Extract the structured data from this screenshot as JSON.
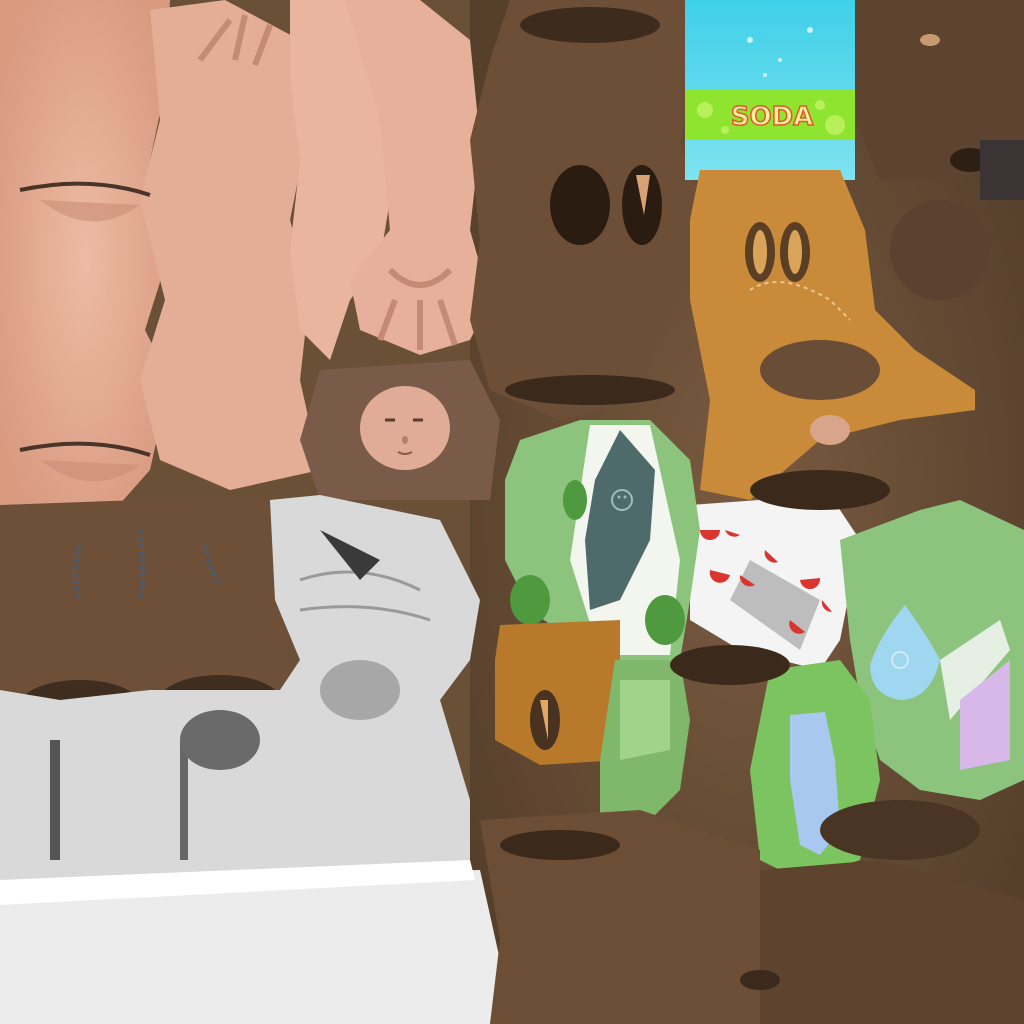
{
  "texture_atlas": {
    "soda_can": {
      "label": "SODA",
      "colors": {
        "label_fill": "#f7f2a0",
        "label_outline": "#e8552a",
        "band_green": "#8ee42e",
        "liquid_cyan": "#4fd2e6"
      }
    },
    "colors": {
      "background_brown": "#6b5038",
      "skin": "#e8b49c",
      "grey_cloth": "#d9d9d9",
      "orange_fabric": "#c98a3a",
      "green_fabric": "#8cc47e",
      "watermelon_red": "#d9362f",
      "water_blue": "#9fd6f0"
    },
    "icons": [
      "smiley-icon",
      "watermelon-slice-icon",
      "water-drop-icon",
      "face-icon"
    ]
  }
}
